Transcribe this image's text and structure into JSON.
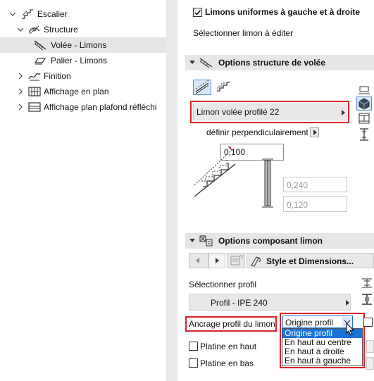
{
  "tree": {
    "items": [
      {
        "label": "Escalier",
        "icon": "stair-icon"
      },
      {
        "label": "Structure",
        "icon": "structure-icon"
      },
      {
        "label": "Volée - Limons",
        "icon": "flight-stringer-icon"
      },
      {
        "label": "Palier - Limons",
        "icon": "landing-stringer-icon"
      },
      {
        "label": "Finition",
        "icon": "finish-icon"
      },
      {
        "label": "Affichage en plan",
        "icon": "floorplan-icon"
      },
      {
        "label": "Affichage plan plafond réfléchi",
        "icon": "ceiling-plan-icon"
      }
    ]
  },
  "panel": {
    "uniform_checkbox_label": "Limons uniformes à gauche et à droite",
    "uniform_checked": true,
    "select_stringer_label": "Sélectionner limon à éditer",
    "section1_title": "Options structure de volée",
    "profile_selector_label": "Limon volée profilé 22",
    "perpendicular_label": "définir perpendiculairement",
    "thickness_value": "0,100",
    "dim_a_value": "0,240",
    "dim_b_value": "0,120",
    "section2_title": "Options composant limon",
    "style_button_label": "Style et Dimensions...",
    "select_profile_label": "Sélectionner profil",
    "profile_value": "Profil - IPE 240",
    "anchor_label": "Ancrage profil du limon",
    "anchor_selected": "Origine profil",
    "anchor_options": [
      "Origine profil",
      "En haut au centre",
      "En haut à droite",
      "En haut à gauche"
    ],
    "top_plate_label": "Platine en haut",
    "bottom_plate_label": "Platine en bas"
  },
  "colors": {
    "highlight_red": "#e0202a",
    "selection_blue": "#1a73d9",
    "tree_selected_bg": "#e5e5e5"
  }
}
